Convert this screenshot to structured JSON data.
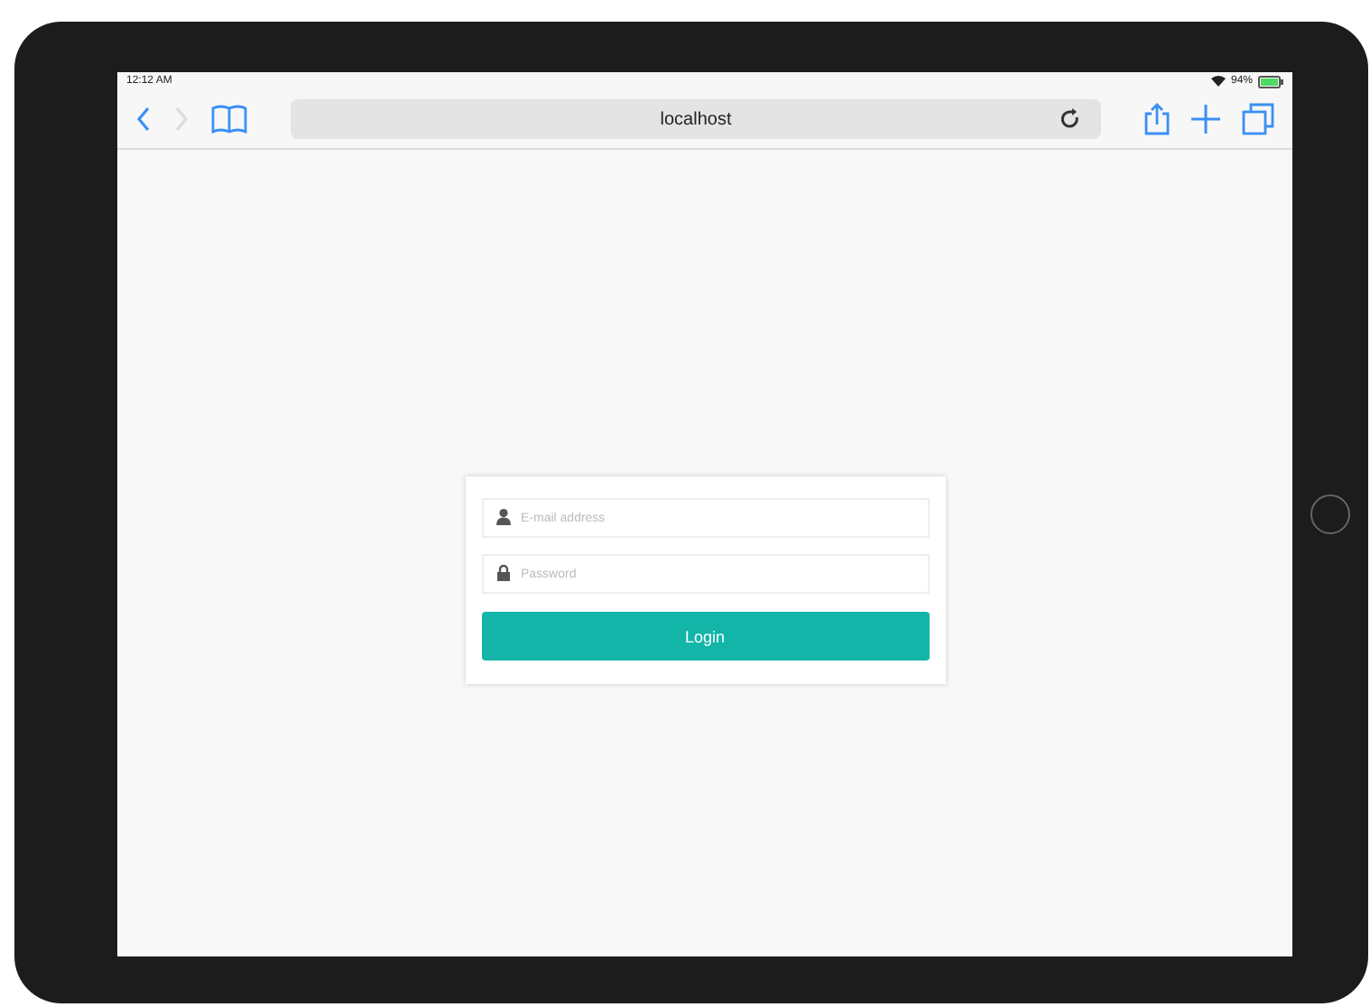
{
  "status_bar": {
    "time": "12:12 AM",
    "battery": "94%"
  },
  "toolbar": {
    "back": {
      "disabled": false
    },
    "forward": {
      "disabled": true
    },
    "address": "localhost"
  },
  "login_form": {
    "email": {
      "placeholder": "E-mail address"
    },
    "password": {
      "placeholder": "Password"
    },
    "button": "Login"
  }
}
